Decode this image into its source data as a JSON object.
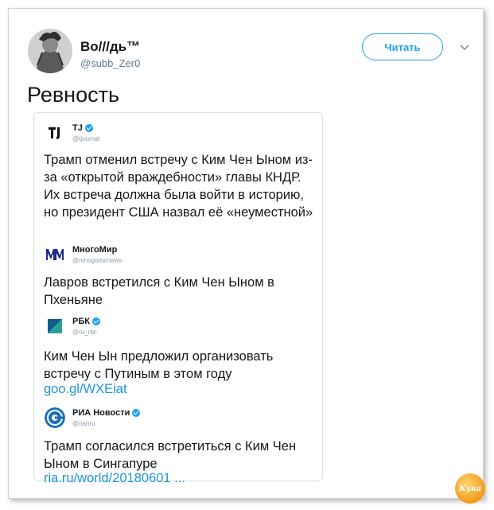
{
  "author": {
    "name": "Bo///дь™",
    "handle": "@subb_Zer0",
    "follow_label": "Читать"
  },
  "tweet": {
    "text": "Ревность"
  },
  "quotes": [
    {
      "source_name": "TJ",
      "source_handle": "@tjournal",
      "verified": true,
      "text": "Трамп отменил встречу с Ким Чен Ыном из-за «открытой враждебности» главы КНДР. Их встреча должна была войти в историю, но президент США назвал её «неуместной»",
      "link": ""
    },
    {
      "source_name": "МногоМир",
      "source_handle": "@mnogomirnews",
      "verified": false,
      "text": "Лавров встретился с Ким Чен Ыном в Пхеньяне",
      "link": ""
    },
    {
      "source_name": "РБК",
      "source_handle": "@ru_rbc",
      "verified": true,
      "text": "Ким Чен Ын предложил организовать встречу с Путиным в этом году",
      "link": "goo.gl/WXEiat"
    },
    {
      "source_name": "РИА Новости",
      "source_handle": "@rianru",
      "verified": true,
      "text": "Трамп согласился встретиться с Ким Чен Ыном в Сингапуре",
      "link": "ria.ru/world/20180601 ..."
    }
  ],
  "watermark": {
    "text": "Кука"
  },
  "colors": {
    "accent": "#1da1f2",
    "link": "#1b95e0",
    "text": "#14171a",
    "muted": "#657786"
  }
}
